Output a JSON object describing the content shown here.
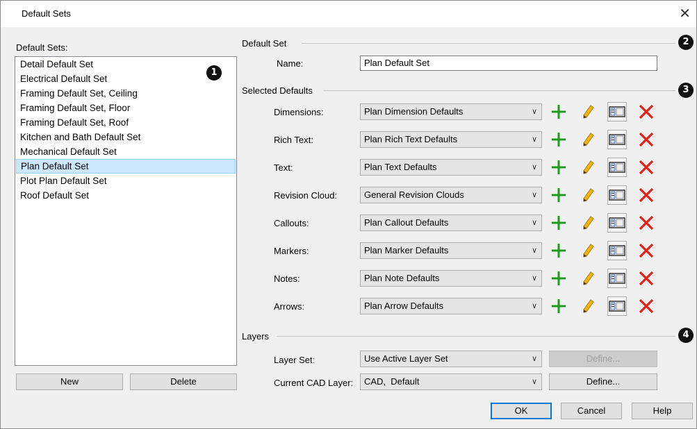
{
  "window": {
    "title": "Default Sets",
    "close": "✕"
  },
  "left": {
    "label": "Default Sets:",
    "items": [
      "Detail Default Set",
      "Electrical Default Set",
      "Framing Default Set, Ceiling",
      "Framing Default Set, Floor",
      "Framing Default Set, Roof",
      "Kitchen and Bath Default Set",
      "Mechanical Default Set",
      "Plan Default Set",
      "Plot Plan Default Set",
      "Roof Default Set"
    ],
    "selected_index": 7,
    "new_label": "New",
    "delete_label": "Delete"
  },
  "badges": [
    "1",
    "2",
    "3",
    "4"
  ],
  "default_set": {
    "group_label": "Default Set",
    "name_label": "Name:",
    "name_value": "Plan Default Set"
  },
  "selected_defaults": {
    "group_label": "Selected Defaults",
    "rows": [
      {
        "label": "Dimensions:",
        "value": "Plan Dimension Defaults"
      },
      {
        "label": "Rich Text:",
        "value": "Plan Rich Text Defaults"
      },
      {
        "label": "Text:",
        "value": "Plan Text Defaults"
      },
      {
        "label": "Revision Cloud:",
        "value": "General Revision Clouds"
      },
      {
        "label": "Callouts:",
        "value": "Plan Callout Defaults"
      },
      {
        "label": "Markers:",
        "value": "Plan Marker Defaults"
      },
      {
        "label": "Notes:",
        "value": "Plan Note Defaults"
      },
      {
        "label": "Arrows:",
        "value": "Plan Arrow Defaults"
      }
    ],
    "row_icons": [
      "add-icon",
      "edit-pencil-icon",
      "properties-icon",
      "delete-icon"
    ]
  },
  "layers": {
    "group_label": "Layers",
    "layer_set_label": "Layer Set:",
    "layer_set_value": "Use Active Layer Set",
    "define_disabled_label": "Define...",
    "cad_layer_label": "Current CAD Layer:",
    "cad_layer_value": "CAD,  Default",
    "define_label": "Define..."
  },
  "footer": {
    "ok": "OK",
    "cancel": "Cancel",
    "help": "Help"
  },
  "colors": {
    "accent": "#0078d7",
    "add": "#1e9e1e",
    "delete": "#e0201a",
    "pencil": "#f2b707",
    "selection": "#cce8ff"
  }
}
